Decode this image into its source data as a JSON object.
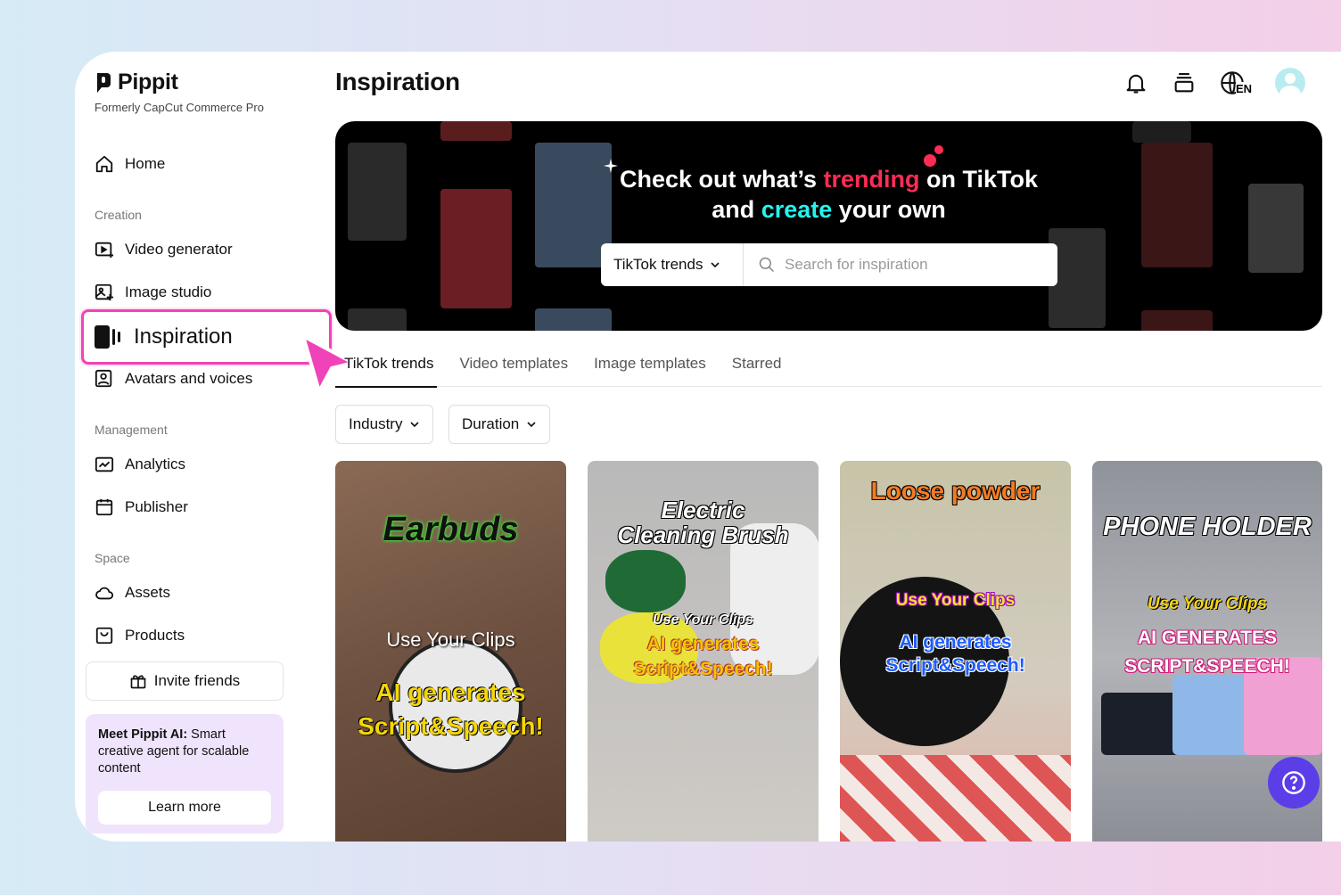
{
  "brand": {
    "name": "Pippit",
    "tagline": "Formerly CapCut Commerce Pro"
  },
  "sidebar": {
    "home": "Home",
    "sections": {
      "creation": "Creation",
      "management": "Management",
      "space": "Space"
    },
    "items": {
      "video_generator": "Video generator",
      "image_studio": "Image studio",
      "inspiration": "Inspiration",
      "avatars": "Avatars and voices",
      "analytics": "Analytics",
      "publisher": "Publisher",
      "assets": "Assets",
      "products": "Products"
    },
    "invite": "Invite friends",
    "promo": {
      "bold": "Meet Pippit AI:",
      "text": " Smart creative agent for scalable content",
      "button": "Learn more"
    }
  },
  "header": {
    "title": "Inspiration",
    "language": "EN"
  },
  "banner": {
    "line1_a": "Check out what’s ",
    "line1_highlight": "trending",
    "line1_b": " on TikTok",
    "line2_a": "and ",
    "line2_highlight": "create",
    "line2_b": " your own",
    "select": "TikTok trends",
    "search_placeholder": "Search for inspiration"
  },
  "tabs": [
    "TikTok trends",
    "Video templates",
    "Image templates",
    "Starred"
  ],
  "filters": [
    "Industry",
    "Duration"
  ],
  "cards": [
    {
      "title": "Earbuds",
      "line1": "Use Your Clips",
      "line2": "AI generates",
      "line3": "Script&Speech!"
    },
    {
      "title1": "Electric",
      "title2": "Cleaning Brush",
      "line1": "Use Your Clips",
      "line2": "AI generates",
      "line3": "Script&Speech!"
    },
    {
      "title": "Loose powder",
      "line1": "Use Your Clips",
      "line2": "AI generates",
      "line3": "Script&Speech!"
    },
    {
      "title": "PHONE HOLDER",
      "line1": "Use Your Clips",
      "line2": "AI GENERATES",
      "line3": "SCRIPT&SPEECH!"
    }
  ],
  "colors": {
    "accent_pink": "#f043b7",
    "tiktok_pink": "#fe2c55",
    "tiktok_cyan": "#25f4ee",
    "help_button": "#5b3ee8",
    "promo_bg": "#efe4fb"
  }
}
